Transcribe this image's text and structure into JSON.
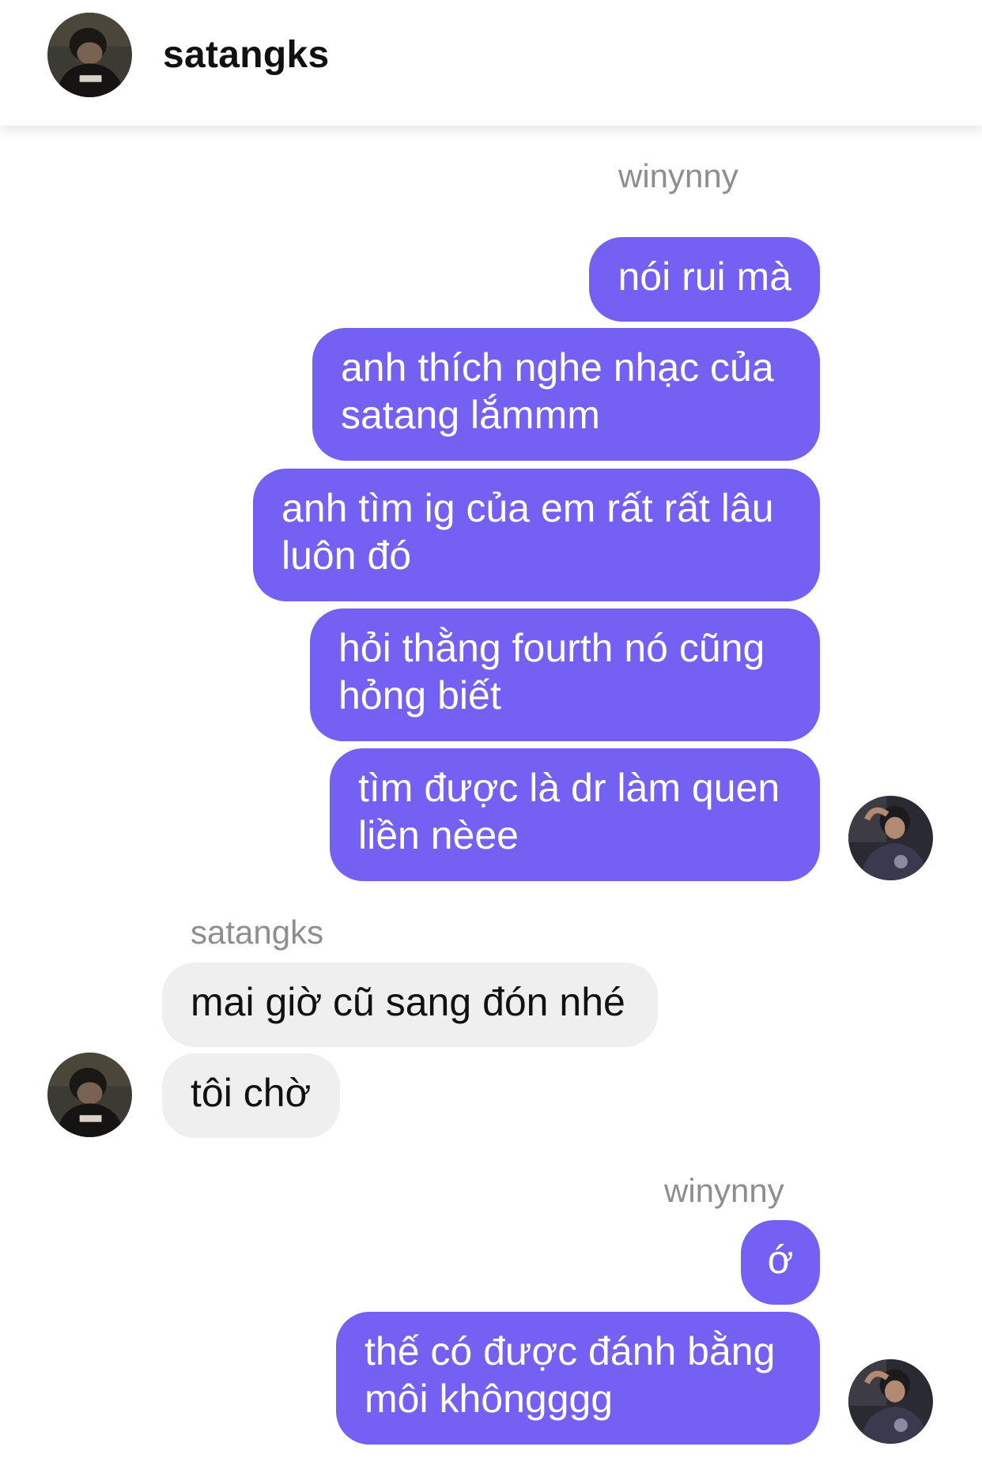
{
  "header": {
    "username": "satangks",
    "avatar_icon": "profile-photo-satangks"
  },
  "thread": {
    "groups": [
      {
        "sender": "winynny",
        "direction": "outgoing",
        "messages": [
          "nói rui mà",
          "anh thích nghe nhạc của\nsatang lắmmm",
          "anh tìm ig của em rất rất lâu\nluôn đó",
          "hỏi thằng fourth nó cũng\nhỏng biết",
          "tìm được là dr làm quen\nliền nèee"
        ],
        "avatar_icon": "profile-photo-winynny"
      },
      {
        "sender": "satangks",
        "direction": "incoming",
        "messages": [
          "mai giờ cũ sang đón nhé",
          "tôi chờ"
        ],
        "avatar_icon": "profile-photo-satangks"
      },
      {
        "sender": "winynny",
        "direction": "outgoing",
        "messages": [
          "ớ",
          "thế có được đánh bằng\nmôi khôngggg"
        ],
        "avatar_icon": "profile-photo-winynny"
      }
    ]
  },
  "colors": {
    "outgoing_bubble": "#7560f4",
    "incoming_bubble": "#efefef",
    "sender_label": "#8e8e8e"
  }
}
